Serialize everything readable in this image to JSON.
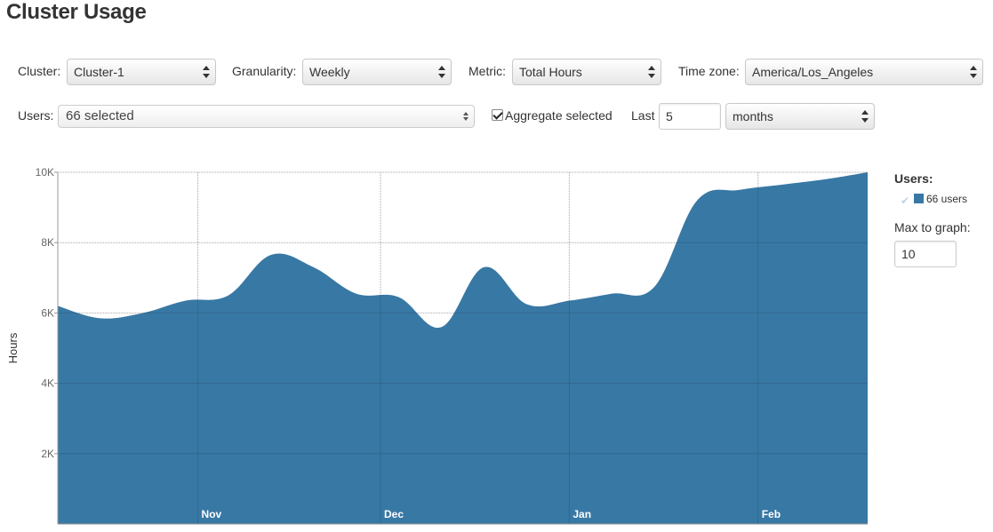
{
  "page": {
    "title": "Cluster Usage"
  },
  "controls": {
    "cluster": {
      "label": "Cluster:",
      "value": "Cluster-1"
    },
    "granularity": {
      "label": "Granularity:",
      "value": "Weekly"
    },
    "metric": {
      "label": "Metric:",
      "value": "Total Hours"
    },
    "timezone": {
      "label": "Time zone:",
      "value": "America/Los_Angeles"
    },
    "users": {
      "label": "Users:",
      "value": "66 selected"
    },
    "aggregate": {
      "label": "Aggregate selected",
      "checked": true
    },
    "last": {
      "label": "Last",
      "value": "5",
      "unit": "months"
    }
  },
  "legend": {
    "title": "Users:",
    "entry": "66 users",
    "max_label": "Max to graph:",
    "max_value": "10"
  },
  "colors": {
    "area": "#3878a4",
    "grid": "#cccccc"
  },
  "chart_data": {
    "type": "area",
    "ylabel": "Hours",
    "xlabel": "",
    "ylim": [
      0,
      10000
    ],
    "y_ticks": [
      "2K",
      "4K",
      "6K",
      "8K",
      "10K"
    ],
    "x_ticks": [
      "Nov",
      "Dec",
      "Jan",
      "Feb"
    ],
    "grid": true,
    "legend_position": "right",
    "series": [
      {
        "name": "66 users",
        "x": [
          "2012-10-09",
          "2012-10-16",
          "2012-10-23",
          "2012-10-30",
          "2012-11-06",
          "2012-11-13",
          "2012-11-20",
          "2012-11-27",
          "2012-12-04",
          "2012-12-11",
          "2012-12-18",
          "2012-12-25",
          "2013-01-01",
          "2013-01-08",
          "2013-01-15",
          "2013-01-22",
          "2013-01-29",
          "2013-02-05",
          "2013-02-12",
          "2013-02-19"
        ],
        "values": [
          6200,
          5850,
          6000,
          6350,
          6500,
          7650,
          7300,
          6550,
          6450,
          5600,
          7300,
          6250,
          6350,
          6550,
          6750,
          9200,
          9500,
          9650,
          9800,
          10000
        ]
      }
    ]
  }
}
